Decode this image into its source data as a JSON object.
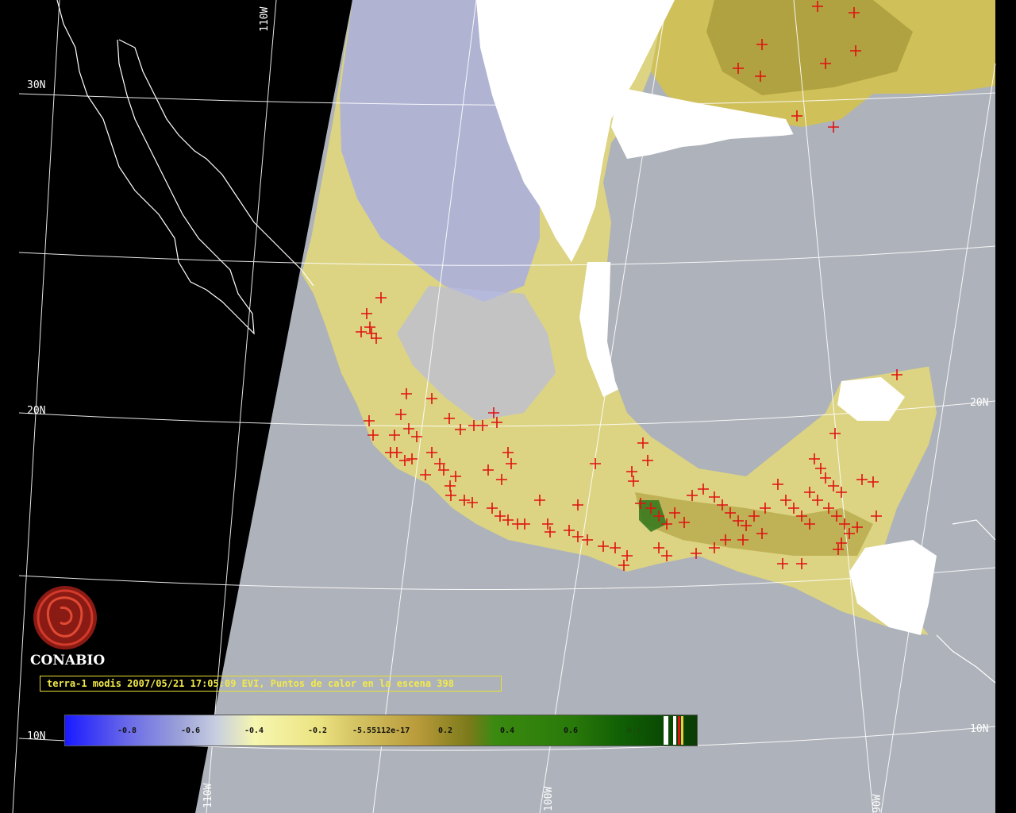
{
  "map": {
    "title": "terra-1 modis 2007/05/21 17:05:09 EVI, Puntos de calor en la escena 398",
    "logo_text": "CONABIO",
    "lat_labels": [
      "30N",
      "20N",
      "10N",
      "20N",
      "10N"
    ],
    "lon_labels": [
      "110W",
      "110W",
      "100W",
      "90W"
    ],
    "colorbar_labels": [
      "-0.8",
      "-0.6",
      "-0.4",
      "-0.2",
      "-5.55112e-17",
      "0.2",
      "0.4",
      "0.6",
      "0.8"
    ],
    "colors": {
      "background": "#000000",
      "no_data": "#aeb2ba",
      "cloud": "#ffffff",
      "hotspot": "#e01010",
      "grid": "#ffffff",
      "caption": "#f2ea4a"
    }
  }
}
